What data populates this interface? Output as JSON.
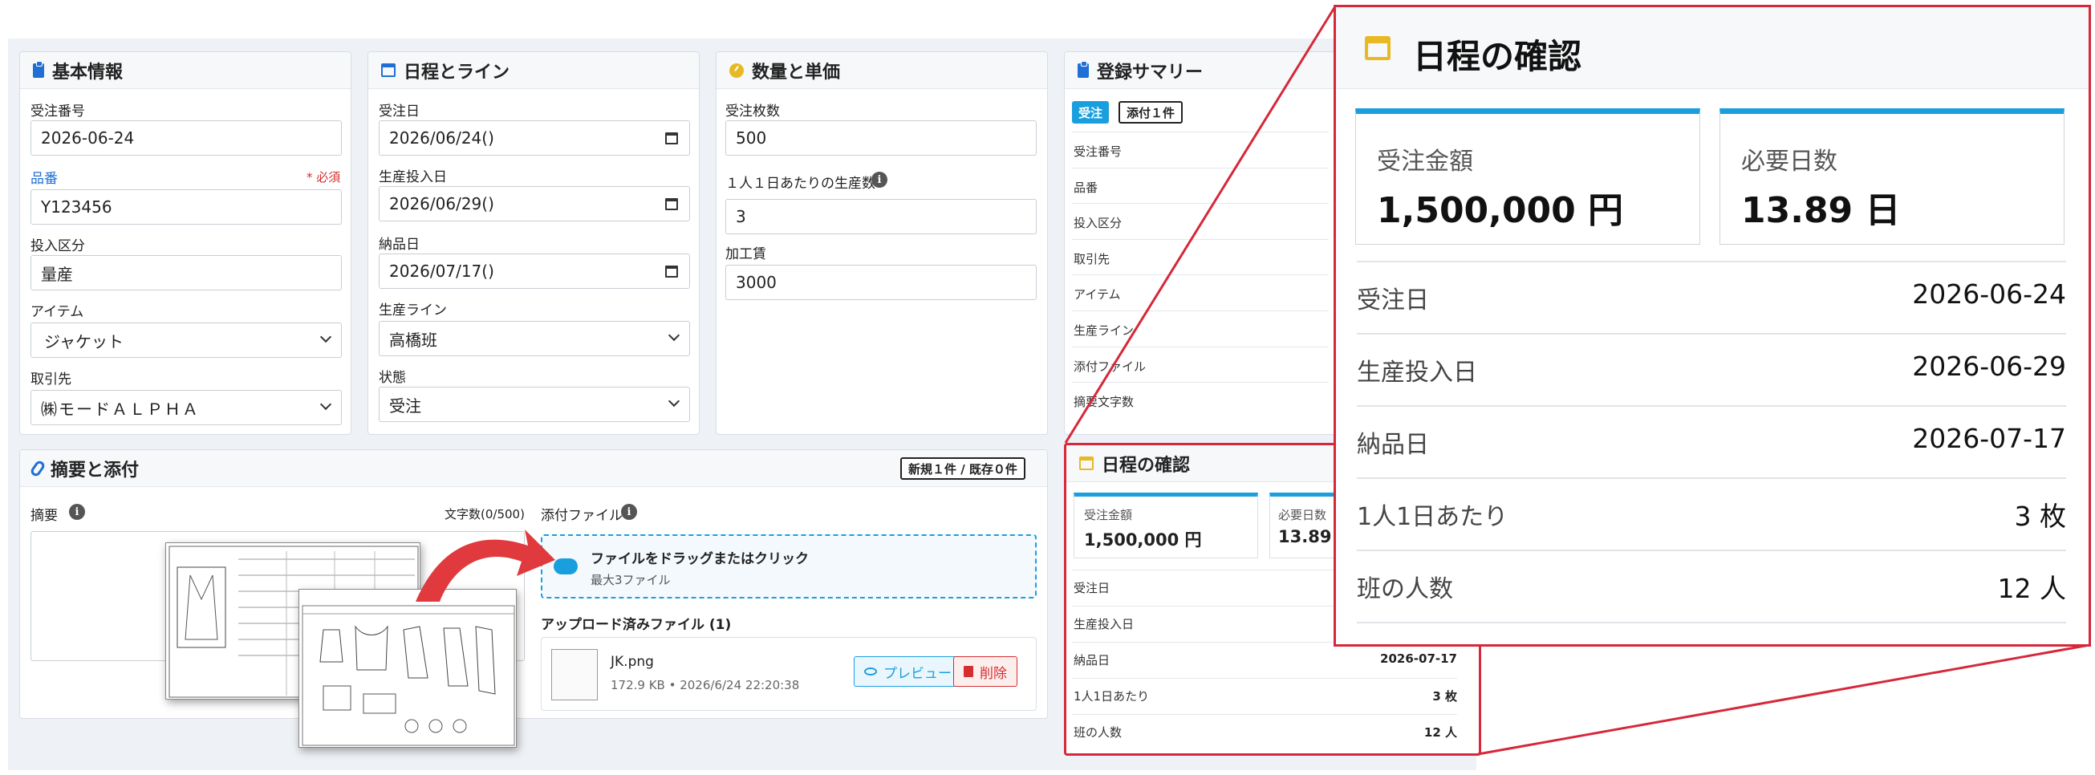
{
  "basic": {
    "title": "基本情報",
    "order_no_label": "受注番号",
    "order_no": "2026-06-24",
    "part_label": "品番",
    "required": "* 必須",
    "part_value": "Y123456",
    "input_type_label": "投入区分",
    "input_type": "量産",
    "item_label": "アイテム",
    "item_value": "ジャケット",
    "client_label": "取引先",
    "client_value": "㈱モードＡＬＰＨＡ"
  },
  "schedule": {
    "title": "日程とライン",
    "order_date_label": "受注日",
    "order_date": "2026/06/24()",
    "prod_date_label": "生産投入日",
    "prod_date": "2026/06/29()",
    "delivery_label": "納品日",
    "delivery_date": "2026/07/17()",
    "line_label": "生産ライン",
    "line_value": "高橋班",
    "status_label": "状態",
    "status_value": "受注"
  },
  "quantity": {
    "title": "数量と単価",
    "qty_label": "受注枚数",
    "qty_value": "500",
    "per_day_label": "１人１日あたりの生産数",
    "per_day_value": "3",
    "fee_label": "加工賃",
    "fee_value": "3000"
  },
  "summary": {
    "title": "登録サマリー",
    "badge_status": "受注",
    "badge_attach": "添付１件",
    "rows": [
      "受注番号",
      "品番",
      "投入区分",
      "取引先",
      "アイテム",
      "生産ライン",
      "添付ファイル",
      "摘要文字数"
    ]
  },
  "notes": {
    "title": "摘要と添付",
    "counter_badge": "新規１件 / 既存０件",
    "memo_label": "摘要",
    "char_count": "文字数(0/500)",
    "attach_label": "添付ファイル",
    "drop_text": "ファイルをドラッグまたはクリック",
    "drop_sub": "最大3ファイル",
    "uploaded_label": "アップロード済みファイル (1)",
    "file_name": "JK.png",
    "file_meta": "172.9 KB • 2026/6/24 22:20:38",
    "preview_btn": "プレビュー",
    "delete_btn": "削除"
  },
  "confirm_small": {
    "title": "日程の確認",
    "stat1_label": "受注金額",
    "stat1_value": "1,500,000 円",
    "stat2_label": "必要日数",
    "stat2_value": "13.89",
    "rows": [
      {
        "k": "受注日",
        "v": ""
      },
      {
        "k": "生産投入日",
        "v": ""
      },
      {
        "k": "納品日",
        "v": "2026-07-17"
      },
      {
        "k": "1人1日あたり",
        "v": "3 枚"
      },
      {
        "k": "班の人数",
        "v": "12 人"
      }
    ]
  },
  "confirm_zoom": {
    "title": "日程の確認",
    "stat1_label": "受注金額",
    "stat1_value": "1,500,000 円",
    "stat2_label": "必要日数",
    "stat2_value": "13.89 日",
    "rows": [
      {
        "k": "受注日",
        "v": "2026-06-24"
      },
      {
        "k": "生産投入日",
        "v": "2026-06-29"
      },
      {
        "k": "納品日",
        "v": "2026-07-17"
      },
      {
        "k": "1人1日あたり",
        "v": "3 枚"
      },
      {
        "k": "班の人数",
        "v": "12 人"
      }
    ]
  },
  "colors": {
    "accent": "#1a9fde",
    "primary": "#1f6fd6",
    "danger": "#d32f2f",
    "highlight": "#d6283a",
    "gold": "#e8b923"
  }
}
